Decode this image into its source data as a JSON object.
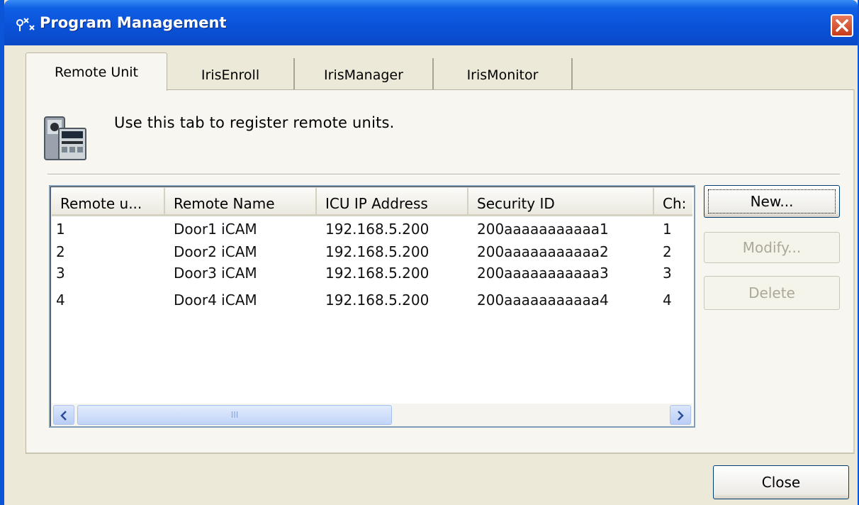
{
  "window": {
    "title": "Program Management"
  },
  "tabs": [
    {
      "label": "Remote Unit"
    },
    {
      "label": "IrisEnroll"
    },
    {
      "label": "IrisManager"
    },
    {
      "label": "IrisMonitor"
    }
  ],
  "panel": {
    "description": "Use this tab to register remote units."
  },
  "list": {
    "columns": [
      "Remote u...",
      "Remote Name",
      "ICU IP Address",
      "Security ID",
      "Ch:"
    ],
    "rows": [
      [
        "1",
        "Door1 iCAM",
        "192.168.5.200",
        "200aaaaaaaaaaa1",
        "1"
      ],
      [
        "2",
        "Door2 iCAM",
        "192.168.5.200",
        "200aaaaaaaaaaa2",
        "2"
      ],
      [
        "3",
        "Door3 iCAM",
        "192.168.5.200",
        "200aaaaaaaaaaa3",
        "3"
      ],
      [
        "4",
        "Door4 iCAM",
        "192.168.5.200",
        "200aaaaaaaaaaa4",
        "4"
      ]
    ],
    "scrollbar_grip": "III"
  },
  "buttons": {
    "new": "New...",
    "modify": "Modify...",
    "delete": "Delete",
    "close": "Close"
  },
  "colors": {
    "titlebar": "#0a52d8",
    "face": "#ece9d8",
    "close_red": "#c63a18"
  }
}
